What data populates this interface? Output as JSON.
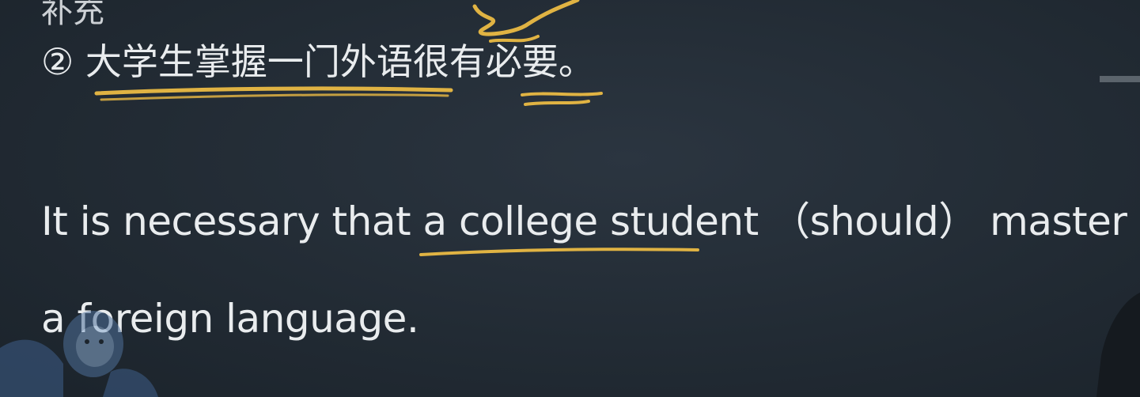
{
  "example": {
    "cropped_top_text": "补充",
    "chinese_sentence": "② 大学生掌握一门外语很有必要。",
    "english_line_1": {
      "before": "It is necessary that ",
      "underlined": "a college student",
      "after_1": " （should） ",
      "after_2": "master"
    },
    "english_line_2": "a foreign language."
  },
  "colors": {
    "background": "#222b34",
    "text": "#e9ecee",
    "annotation": "#e0b343"
  },
  "icons": {
    "mascot": "cartoon-character-icon",
    "presenter": "presenter-silhouette-icon"
  }
}
